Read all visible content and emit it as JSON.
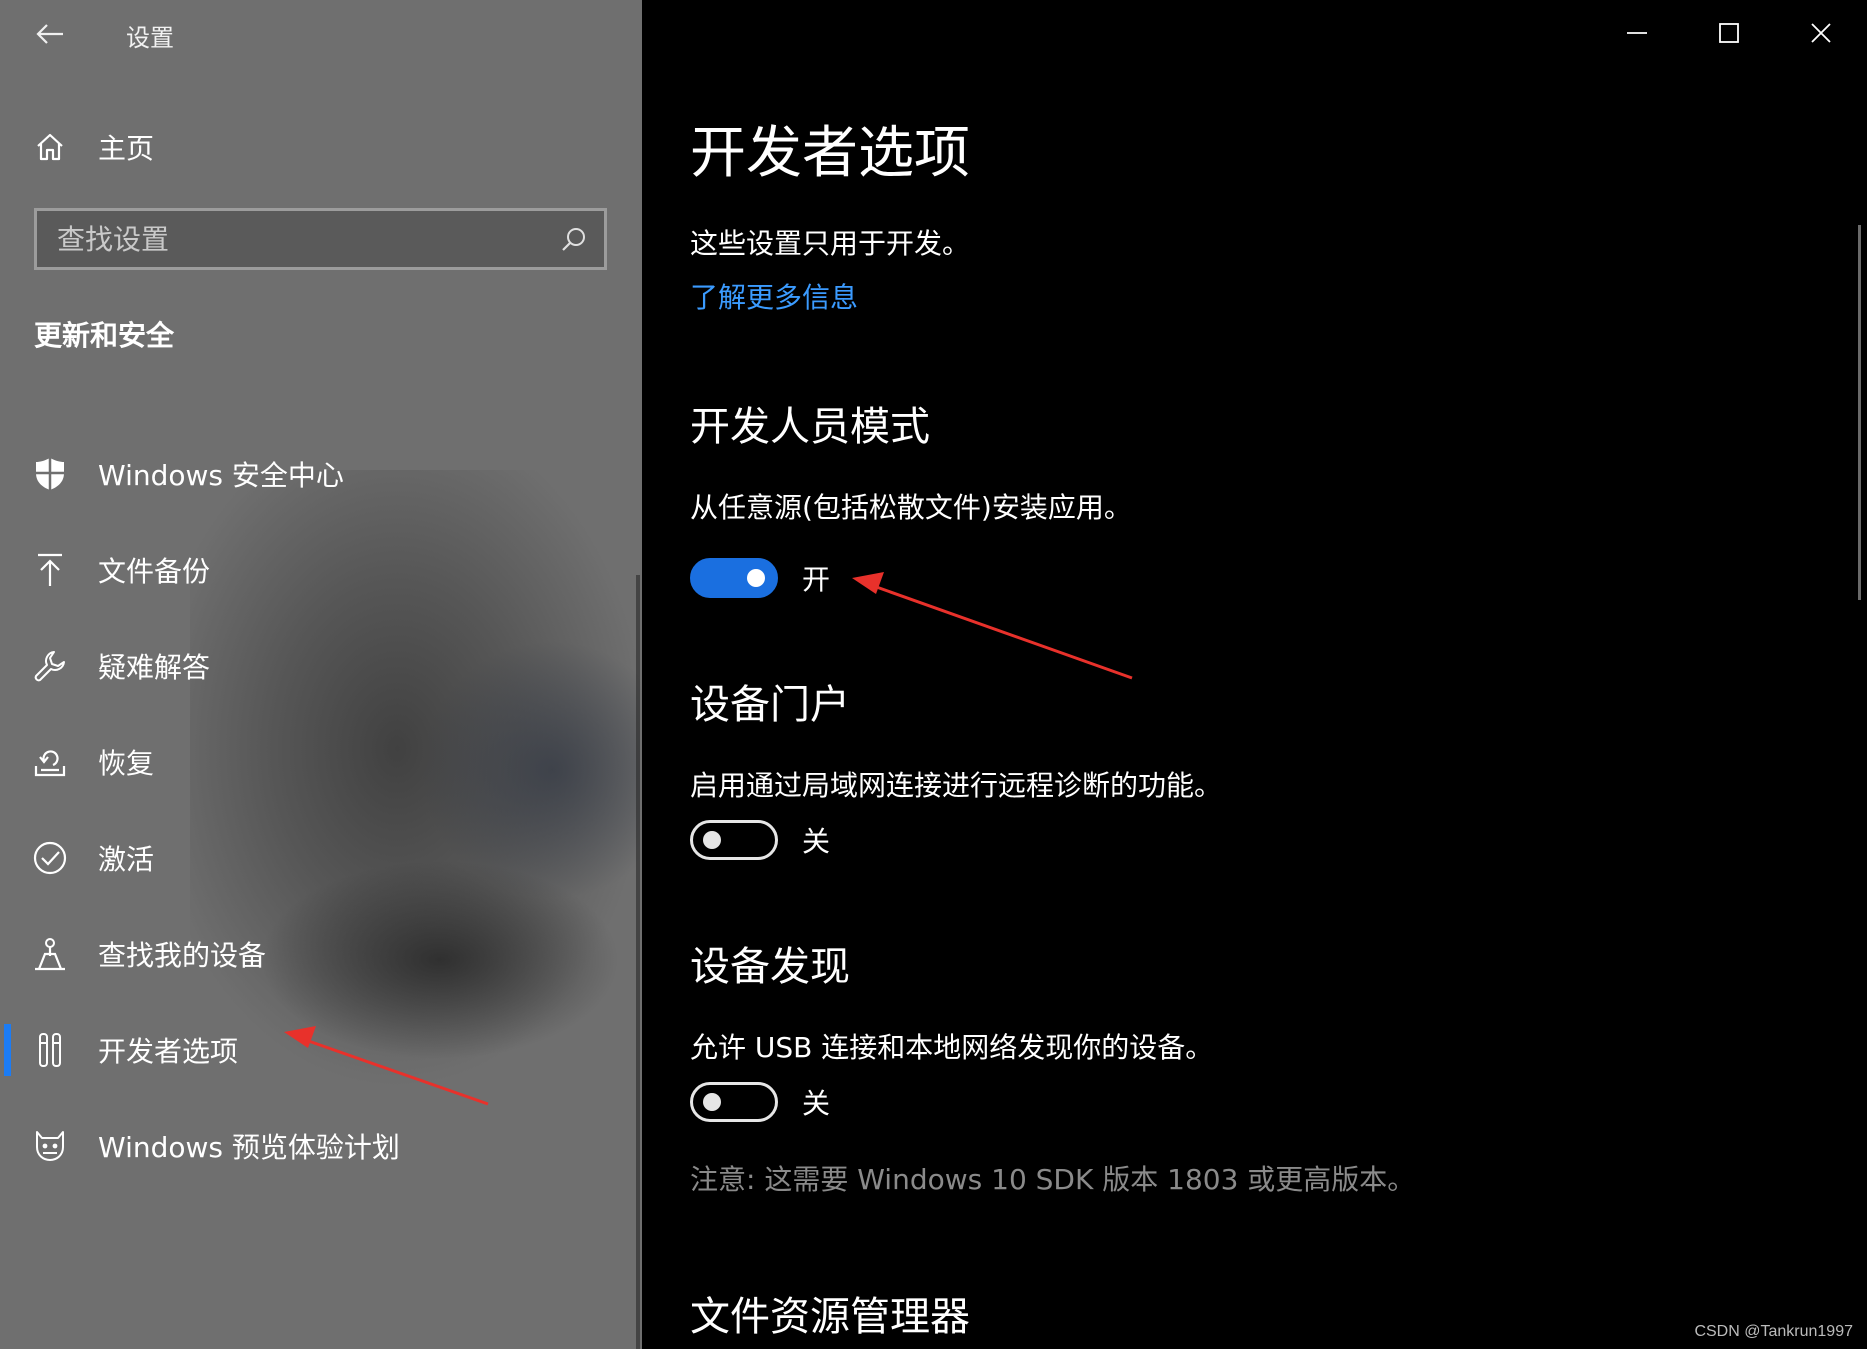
{
  "app": {
    "title": "设置"
  },
  "sidebar": {
    "home_label": "主页",
    "search_placeholder": "查找设置",
    "section_title": "更新和安全",
    "items": [
      {
        "label": "Windows 安全中心",
        "icon": "shield-icon"
      },
      {
        "label": "文件备份",
        "icon": "upload-arrow-icon"
      },
      {
        "label": "疑难解答",
        "icon": "wrench-icon"
      },
      {
        "label": "恢复",
        "icon": "recovery-icon"
      },
      {
        "label": "激活",
        "icon": "check-circle-icon"
      },
      {
        "label": "查找我的设备",
        "icon": "find-device-icon"
      },
      {
        "label": "开发者选项",
        "icon": "developer-tools-icon",
        "selected": true
      },
      {
        "label": "Windows 预览体验计划",
        "icon": "insider-cat-icon"
      }
    ]
  },
  "main": {
    "page_title": "开发者选项",
    "description": "这些设置只用于开发。",
    "learn_more": "了解更多信息",
    "sections": [
      {
        "heading": "开发人员模式",
        "description": "从任意源(包括松散文件)安装应用。",
        "toggle_state": "开",
        "toggle_on": true
      },
      {
        "heading": "设备门户",
        "description": "启用通过局域网连接进行远程诊断的功能。",
        "toggle_state": "关",
        "toggle_on": false
      },
      {
        "heading": "设备发现",
        "description": "允许 USB 连接和本地网络发现你的设备。",
        "toggle_state": "关",
        "toggle_on": false,
        "note": "注意: 这需要 Windows 10 SDK 版本 1803 或更高版本。"
      },
      {
        "heading": "文件资源管理器"
      }
    ]
  },
  "watermark": "CSDN @Tankrun1997",
  "colors": {
    "accent": "#1a6fe0",
    "link": "#3b9bff",
    "annotation_arrow": "#e8312b",
    "sidebar_bg": "#6f6f6f",
    "content_bg": "#000000"
  }
}
